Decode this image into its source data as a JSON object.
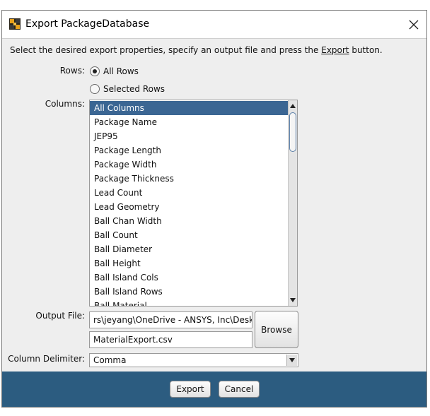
{
  "window": {
    "title": "Export PackageDatabase"
  },
  "instructions": {
    "before": "Select the desired export properties, specify an output file and press the ",
    "link": "Export",
    "after": " button."
  },
  "rows": {
    "label": "Rows:",
    "options": [
      "All Rows",
      "Selected Rows"
    ],
    "selected": "All Rows"
  },
  "columns": {
    "label": "Columns:",
    "items": [
      "All Columns",
      "Package Name",
      "JEP95",
      "Package Length",
      "Package Width",
      "Package Thickness",
      "Lead Count",
      "Lead Geometry",
      "Ball Chan Width",
      "Ball Count",
      "Ball Diameter",
      "Ball Height",
      "Ball Island Cols",
      "Ball Island Rows",
      "Ball Material"
    ],
    "selected": "All Columns"
  },
  "output": {
    "label": "Output File:",
    "directory": "rs\\jeyang\\OneDrive - ANSYS, Inc\\Desktop",
    "filename": "MaterialExport.csv",
    "browse_label": "Browse"
  },
  "delimiter": {
    "label": "Column Delimiter:",
    "value": "Comma"
  },
  "footer": {
    "export_label": "Export",
    "cancel_label": "Cancel"
  },
  "colors": {
    "selection": "#3b6693",
    "footer": "#2c5c80",
    "panel": "#eeeeee"
  }
}
